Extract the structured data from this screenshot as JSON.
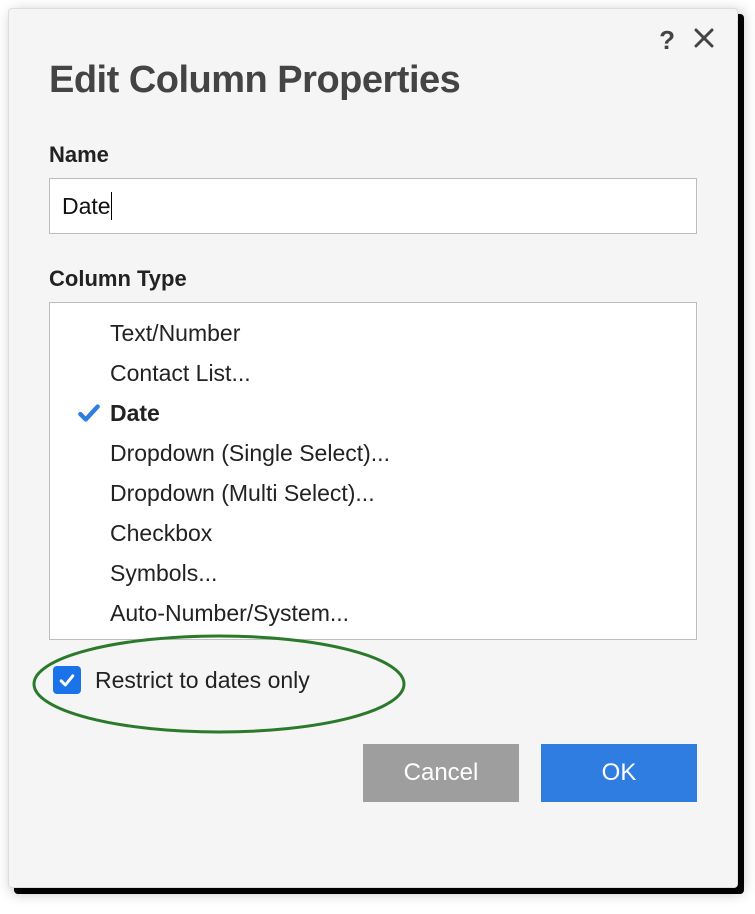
{
  "dialog": {
    "title": "Edit Column Properties",
    "name_label": "Name",
    "name_value": "Date",
    "type_label": "Column Type",
    "type_options": [
      "Text/Number",
      "Contact List...",
      "Date",
      "Dropdown (Single Select)...",
      "Dropdown (Multi Select)...",
      "Checkbox",
      "Symbols...",
      "Auto-Number/System..."
    ],
    "selected_type_index": 2,
    "restrict_label": "Restrict to dates only",
    "restrict_checked": true,
    "cancel_label": "Cancel",
    "ok_label": "OK"
  }
}
